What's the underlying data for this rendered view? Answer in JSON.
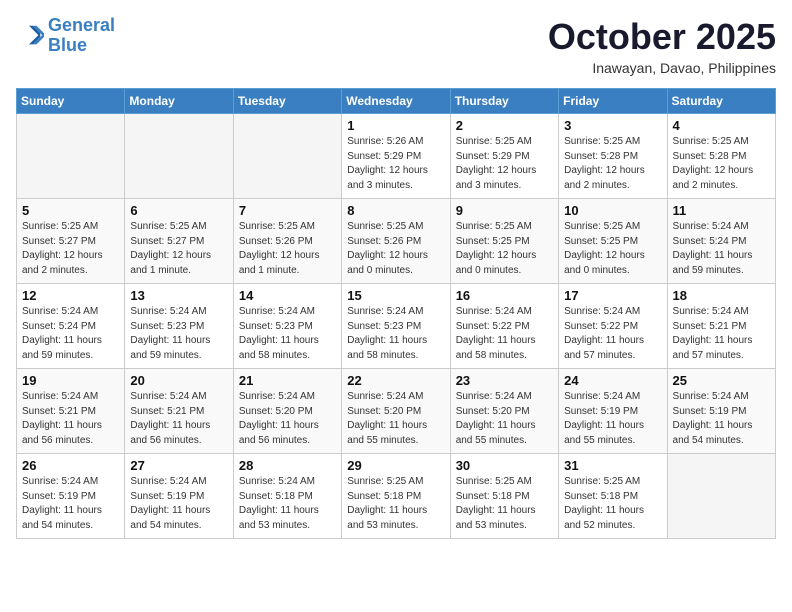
{
  "header": {
    "logo_line1": "General",
    "logo_line2": "Blue",
    "month": "October 2025",
    "location": "Inawayan, Davao, Philippines"
  },
  "weekdays": [
    "Sunday",
    "Monday",
    "Tuesday",
    "Wednesday",
    "Thursday",
    "Friday",
    "Saturday"
  ],
  "weeks": [
    [
      {
        "day": "",
        "info": ""
      },
      {
        "day": "",
        "info": ""
      },
      {
        "day": "",
        "info": ""
      },
      {
        "day": "1",
        "info": "Sunrise: 5:26 AM\nSunset: 5:29 PM\nDaylight: 12 hours\nand 3 minutes."
      },
      {
        "day": "2",
        "info": "Sunrise: 5:25 AM\nSunset: 5:29 PM\nDaylight: 12 hours\nand 3 minutes."
      },
      {
        "day": "3",
        "info": "Sunrise: 5:25 AM\nSunset: 5:28 PM\nDaylight: 12 hours\nand 2 minutes."
      },
      {
        "day": "4",
        "info": "Sunrise: 5:25 AM\nSunset: 5:28 PM\nDaylight: 12 hours\nand 2 minutes."
      }
    ],
    [
      {
        "day": "5",
        "info": "Sunrise: 5:25 AM\nSunset: 5:27 PM\nDaylight: 12 hours\nand 2 minutes."
      },
      {
        "day": "6",
        "info": "Sunrise: 5:25 AM\nSunset: 5:27 PM\nDaylight: 12 hours\nand 1 minute."
      },
      {
        "day": "7",
        "info": "Sunrise: 5:25 AM\nSunset: 5:26 PM\nDaylight: 12 hours\nand 1 minute."
      },
      {
        "day": "8",
        "info": "Sunrise: 5:25 AM\nSunset: 5:26 PM\nDaylight: 12 hours\nand 0 minutes."
      },
      {
        "day": "9",
        "info": "Sunrise: 5:25 AM\nSunset: 5:25 PM\nDaylight: 12 hours\nand 0 minutes."
      },
      {
        "day": "10",
        "info": "Sunrise: 5:25 AM\nSunset: 5:25 PM\nDaylight: 12 hours\nand 0 minutes."
      },
      {
        "day": "11",
        "info": "Sunrise: 5:24 AM\nSunset: 5:24 PM\nDaylight: 11 hours\nand 59 minutes."
      }
    ],
    [
      {
        "day": "12",
        "info": "Sunrise: 5:24 AM\nSunset: 5:24 PM\nDaylight: 11 hours\nand 59 minutes."
      },
      {
        "day": "13",
        "info": "Sunrise: 5:24 AM\nSunset: 5:23 PM\nDaylight: 11 hours\nand 59 minutes."
      },
      {
        "day": "14",
        "info": "Sunrise: 5:24 AM\nSunset: 5:23 PM\nDaylight: 11 hours\nand 58 minutes."
      },
      {
        "day": "15",
        "info": "Sunrise: 5:24 AM\nSunset: 5:23 PM\nDaylight: 11 hours\nand 58 minutes."
      },
      {
        "day": "16",
        "info": "Sunrise: 5:24 AM\nSunset: 5:22 PM\nDaylight: 11 hours\nand 58 minutes."
      },
      {
        "day": "17",
        "info": "Sunrise: 5:24 AM\nSunset: 5:22 PM\nDaylight: 11 hours\nand 57 minutes."
      },
      {
        "day": "18",
        "info": "Sunrise: 5:24 AM\nSunset: 5:21 PM\nDaylight: 11 hours\nand 57 minutes."
      }
    ],
    [
      {
        "day": "19",
        "info": "Sunrise: 5:24 AM\nSunset: 5:21 PM\nDaylight: 11 hours\nand 56 minutes."
      },
      {
        "day": "20",
        "info": "Sunrise: 5:24 AM\nSunset: 5:21 PM\nDaylight: 11 hours\nand 56 minutes."
      },
      {
        "day": "21",
        "info": "Sunrise: 5:24 AM\nSunset: 5:20 PM\nDaylight: 11 hours\nand 56 minutes."
      },
      {
        "day": "22",
        "info": "Sunrise: 5:24 AM\nSunset: 5:20 PM\nDaylight: 11 hours\nand 55 minutes."
      },
      {
        "day": "23",
        "info": "Sunrise: 5:24 AM\nSunset: 5:20 PM\nDaylight: 11 hours\nand 55 minutes."
      },
      {
        "day": "24",
        "info": "Sunrise: 5:24 AM\nSunset: 5:19 PM\nDaylight: 11 hours\nand 55 minutes."
      },
      {
        "day": "25",
        "info": "Sunrise: 5:24 AM\nSunset: 5:19 PM\nDaylight: 11 hours\nand 54 minutes."
      }
    ],
    [
      {
        "day": "26",
        "info": "Sunrise: 5:24 AM\nSunset: 5:19 PM\nDaylight: 11 hours\nand 54 minutes."
      },
      {
        "day": "27",
        "info": "Sunrise: 5:24 AM\nSunset: 5:19 PM\nDaylight: 11 hours\nand 54 minutes."
      },
      {
        "day": "28",
        "info": "Sunrise: 5:24 AM\nSunset: 5:18 PM\nDaylight: 11 hours\nand 53 minutes."
      },
      {
        "day": "29",
        "info": "Sunrise: 5:25 AM\nSunset: 5:18 PM\nDaylight: 11 hours\nand 53 minutes."
      },
      {
        "day": "30",
        "info": "Sunrise: 5:25 AM\nSunset: 5:18 PM\nDaylight: 11 hours\nand 53 minutes."
      },
      {
        "day": "31",
        "info": "Sunrise: 5:25 AM\nSunset: 5:18 PM\nDaylight: 11 hours\nand 52 minutes."
      },
      {
        "day": "",
        "info": ""
      }
    ]
  ]
}
